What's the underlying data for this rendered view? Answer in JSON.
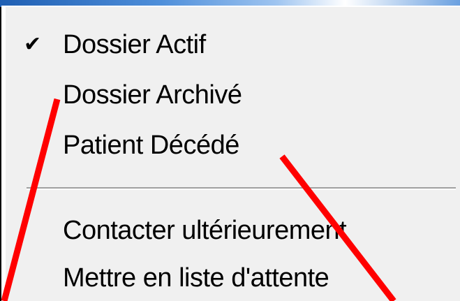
{
  "menu": {
    "items": [
      {
        "label": "Dossier Actif",
        "checked": true
      },
      {
        "label": "Dossier Archivé",
        "checked": false
      },
      {
        "label": "Patient Décédé",
        "checked": false
      },
      {
        "label": "Contacter ultérieurement",
        "checked": false
      },
      {
        "label": "Mettre en liste d'attente",
        "checked": false
      }
    ],
    "check_glyph": "✔"
  },
  "colors": {
    "background": "#000000",
    "menu_background": "#f0f0f0",
    "annotation_line": "#ff0000"
  }
}
